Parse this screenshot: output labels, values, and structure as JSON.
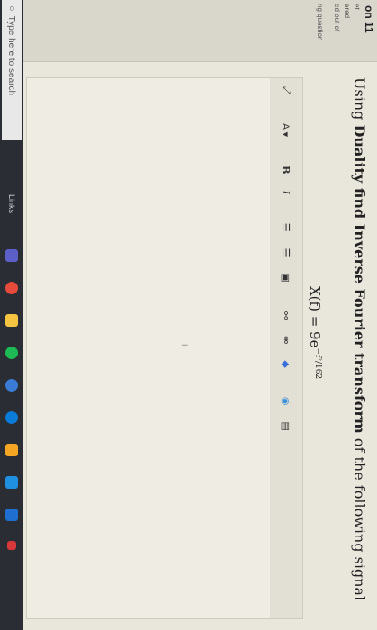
{
  "sidebar": {
    "question_number": "on 11",
    "status_line1": "et",
    "status_line2": "ered",
    "marks_line": "ed out of",
    "flag_line": "ng question"
  },
  "question": {
    "prefix": "Using ",
    "bold_part": "Duality find Inverse Fourier transform",
    "suffix": " of the following signal",
    "formula_lhs": "X(f) = 9e",
    "formula_exp": "−f²/162"
  },
  "toolbar": {
    "expand": "⤢",
    "font_color": "A ▾",
    "bold": "B",
    "italic": "I",
    "bullets": "☰",
    "numbering": "☰",
    "image": "▣",
    "link": "⚯",
    "unlink": "⚮",
    "special": "◆",
    "media": "◉",
    "h5p": "▤"
  },
  "taskbar": {
    "search_placeholder": "Type here to search",
    "links_label": "Links"
  },
  "colors": {
    "chrome": "#e64a3b",
    "store": "#1f8fe0",
    "spotify": "#1db954",
    "edge": "#0a7bd6",
    "office": "#f5a623"
  }
}
